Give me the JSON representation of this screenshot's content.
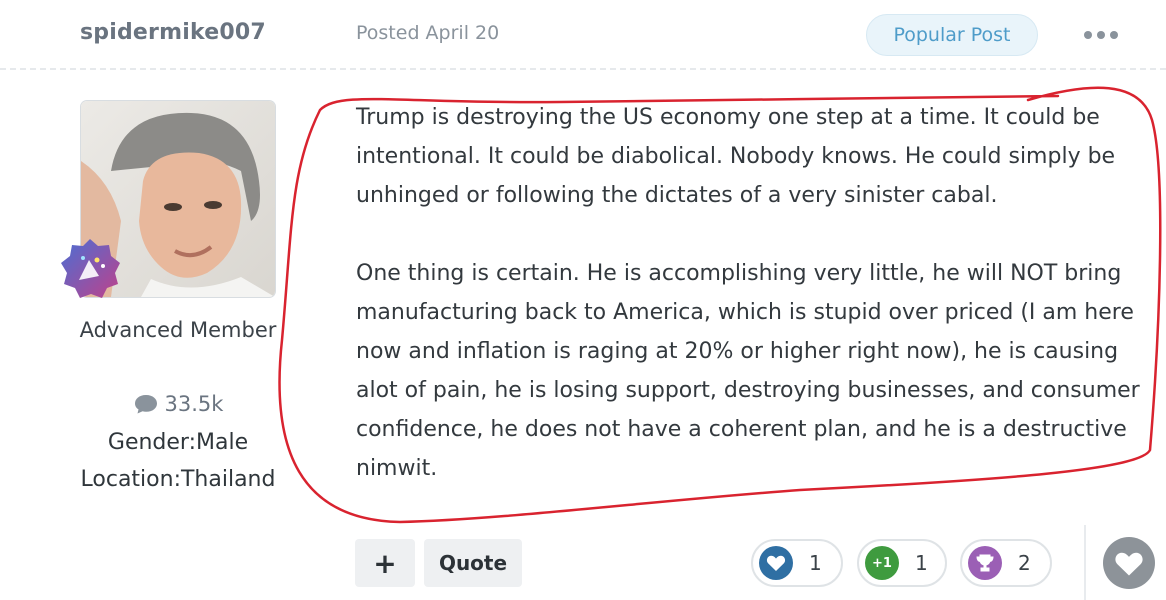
{
  "header": {
    "username": "spidermike007",
    "posted": "Posted April 20",
    "badge": "Popular Post"
  },
  "author": {
    "member_title": "Advanced Member",
    "post_count": "33.5k",
    "gender": "Gender:Male",
    "location": "Location:Thailand"
  },
  "post": {
    "paragraphs": [
      "Trump is destroying the US economy one step at a time. It could be intentional. It could be diabolical. Nobody knows. He could simply be unhinged or following the dictates of a very sinister cabal.",
      "One thing is certain. He is accomplishing very little, he will NOT bring manufacturing back to America, which is stupid over priced (I am here now and inflation is raging at 20% or higher right now), he is causing alot of pain, he is losing support, destroying businesses, and consumer confidence, he does not have a coherent plan, and he is a destructive nimwit."
    ]
  },
  "actions": {
    "plus_label": "+",
    "quote_label": "Quote"
  },
  "reactions": [
    {
      "icon": "heart-icon",
      "count": "1",
      "color": "#2f6fa3"
    },
    {
      "icon": "plus-one-icon",
      "count": "1",
      "color": "#3f9b3f"
    },
    {
      "icon": "trophy-icon",
      "count": "2",
      "color": "#9b5fb5"
    }
  ],
  "colors": {
    "annotation": "#d9232f",
    "badge_text": "#4e9cc9",
    "like_button": "#8d9399"
  },
  "icons": {
    "more": "more-dots-icon",
    "comment": "speech-bubble-icon",
    "rank": "rank-badge-icon",
    "like": "heart-icon"
  }
}
